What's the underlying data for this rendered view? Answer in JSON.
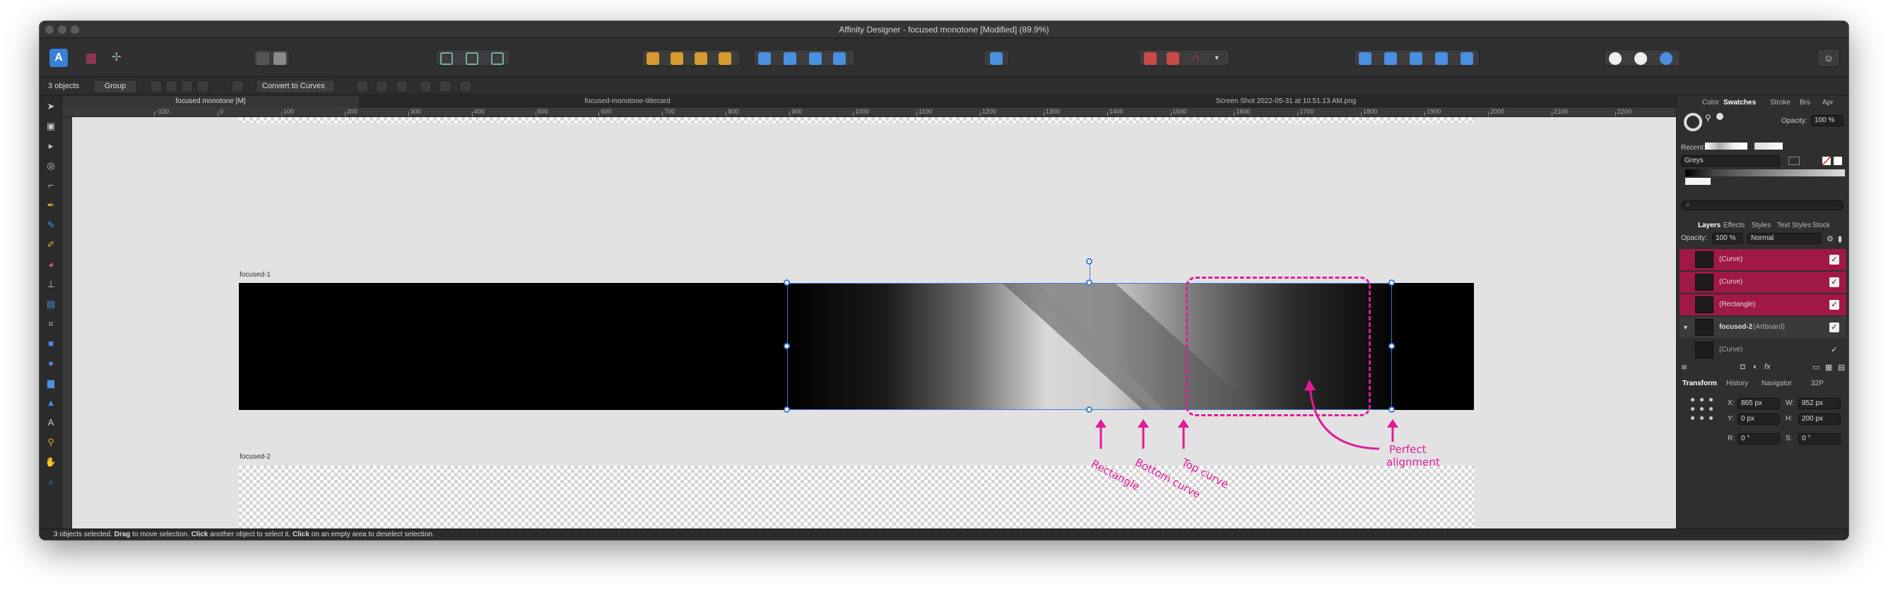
{
  "window": {
    "title": "Affinity Designer - focused monotone [Modified] (89.9%)"
  },
  "context_toolbar": {
    "selection_count": "3 objects",
    "group_button": "Group",
    "convert_button": "Convert to Curves"
  },
  "doc_tabs": [
    {
      "label": "focused monotone [M]",
      "active": true
    },
    {
      "label": "focused-monotone-titlecard",
      "active": false
    },
    {
      "label": "Screen Shot 2022-05-31 at 10.51.13 AM.png",
      "active": false
    }
  ],
  "ruler": {
    "ticks": [
      "-100",
      "0",
      "100",
      "200",
      "300",
      "400",
      "500",
      "600",
      "700",
      "800",
      "900",
      "1000",
      "1100",
      "1200",
      "1300",
      "1400",
      "1500",
      "1600",
      "1700",
      "1800",
      "1900",
      "2000",
      "2100",
      "2200"
    ],
    "unit": "px"
  },
  "canvas": {
    "artboard1_label": "focused-1",
    "artboard2_label": "focused-2"
  },
  "annotations": {
    "rectangle": "Rectangle",
    "bottom_curve": "Bottom curve",
    "top_curve": "Top curve",
    "perfect_line1": "Perfect",
    "perfect_line2": "alignment",
    "color": "#e21b9a"
  },
  "status": {
    "p1": "3 objects selected. ",
    "b1": "Drag",
    "p2": " to move selection. ",
    "b2": "Click",
    "p3": " another object to select it. ",
    "b3": "Click",
    "p4": " on an empty area to deselect selection."
  },
  "right_panel": {
    "top_tabs": [
      "Color",
      "Swatches",
      "Stroke",
      "Brs",
      "Apr"
    ],
    "active_top_tab": "Swatches",
    "opacity_label": "Opacity:",
    "opacity_value": "100 %",
    "recent_label": "Recent:",
    "palette_name": "Greys",
    "layer_tabs": [
      "Layers",
      "Effects",
      "Styles",
      "Text Styles",
      "Stock"
    ],
    "active_layer_tab": "Layers",
    "layer_opacity_label": "Opacity:",
    "layer_opacity_value": "100 %",
    "blend_mode": "Normal",
    "layers": [
      {
        "name": "(Curve)",
        "selected": true
      },
      {
        "name": "(Curve)",
        "selected": true
      },
      {
        "name": "(Rectangle)",
        "selected": true
      },
      {
        "name": "focused-2",
        "suffix": "(Artboard)",
        "selected": false
      },
      {
        "name": "(Curve)",
        "selected": false
      }
    ],
    "bottom_tabs": [
      "Transform",
      "History",
      "Navigator",
      "32P"
    ],
    "active_bottom_tab": "Transform",
    "transform": {
      "x_label": "X:",
      "x_value": "865 px",
      "y_label": "Y:",
      "y_value": "0 px",
      "w_label": "W:",
      "w_value": "952 px",
      "h_label": "H:",
      "h_value": "200 px",
      "r_label": "R:",
      "r_value": "0 °",
      "s_label": "S:",
      "s_value": "0 °"
    }
  },
  "colors": {
    "selection": "#3b7bd8",
    "selected_layer": "#a01844",
    "accent": "#3a7fd8"
  }
}
